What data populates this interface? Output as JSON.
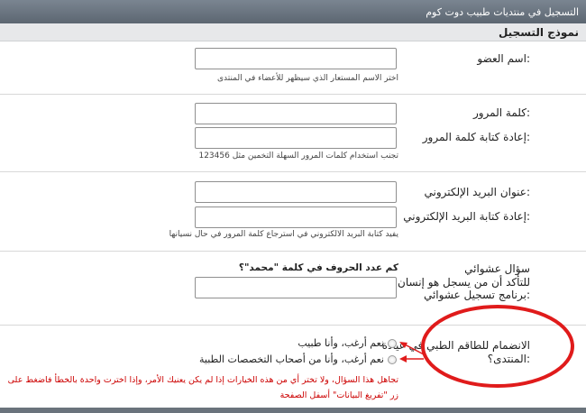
{
  "window": {
    "title": "التسجيل في منتديات طبيب دوت كوم"
  },
  "form": {
    "title": "نموذج التسجيل"
  },
  "fields": {
    "username": {
      "label": "اسم العضو:",
      "hint": "اختر الاسم المستعار الذي سيظهر للأعضاء في المنتدى",
      "value": ""
    },
    "password": {
      "label": "كلمة المرور:",
      "value": ""
    },
    "password_confirm": {
      "label": "إعادة كتابة كلمة المرور:",
      "hint": "تجنب استخدام كلمات المرور السهلة التخمين مثل 123456",
      "value": ""
    },
    "email": {
      "label": "عنوان البريد الإلكتروني:",
      "value": ""
    },
    "email_confirm": {
      "label": "إعادة كتابة البريد الإلكتروني:",
      "hint": "يفيد كتابة البريد الالكتروني في استرجاع كلمة المرور في حال نسيانها",
      "value": ""
    },
    "captcha": {
      "label_line1": "سؤال عشوائي",
      "label_line2": "للتأكد أن من يسجل هو إنسان وليس",
      "label_line3": "برنامج تسجيل عشوائي:",
      "question": "كم عدد الحروف في كلمة \"محمد\"؟",
      "value": ""
    }
  },
  "join_medical": {
    "label_line1": "الانضمام للطاقم الطبي في عيادة",
    "label_line2": "المنتدى؟:",
    "options": [
      "نعم أرغب، وأنا طبيب",
      "نعم أرغب، وأنا من أصحاب التخصصات الطبية"
    ],
    "warning_line1": "تجاهل هذا السؤال، ولا تختر أي من هذه الخيارات إذا لم يكن يعنيك الأمر، وإذا اخترت واحدة بالخطأ فاضغط على",
    "warning_line2": "زر \"تفريغ البيانات\" أسفل الصفحة"
  },
  "colors": {
    "annotation": "#e01b1b",
    "warning_text": "#cc0000",
    "titlebar": "#66707b"
  }
}
